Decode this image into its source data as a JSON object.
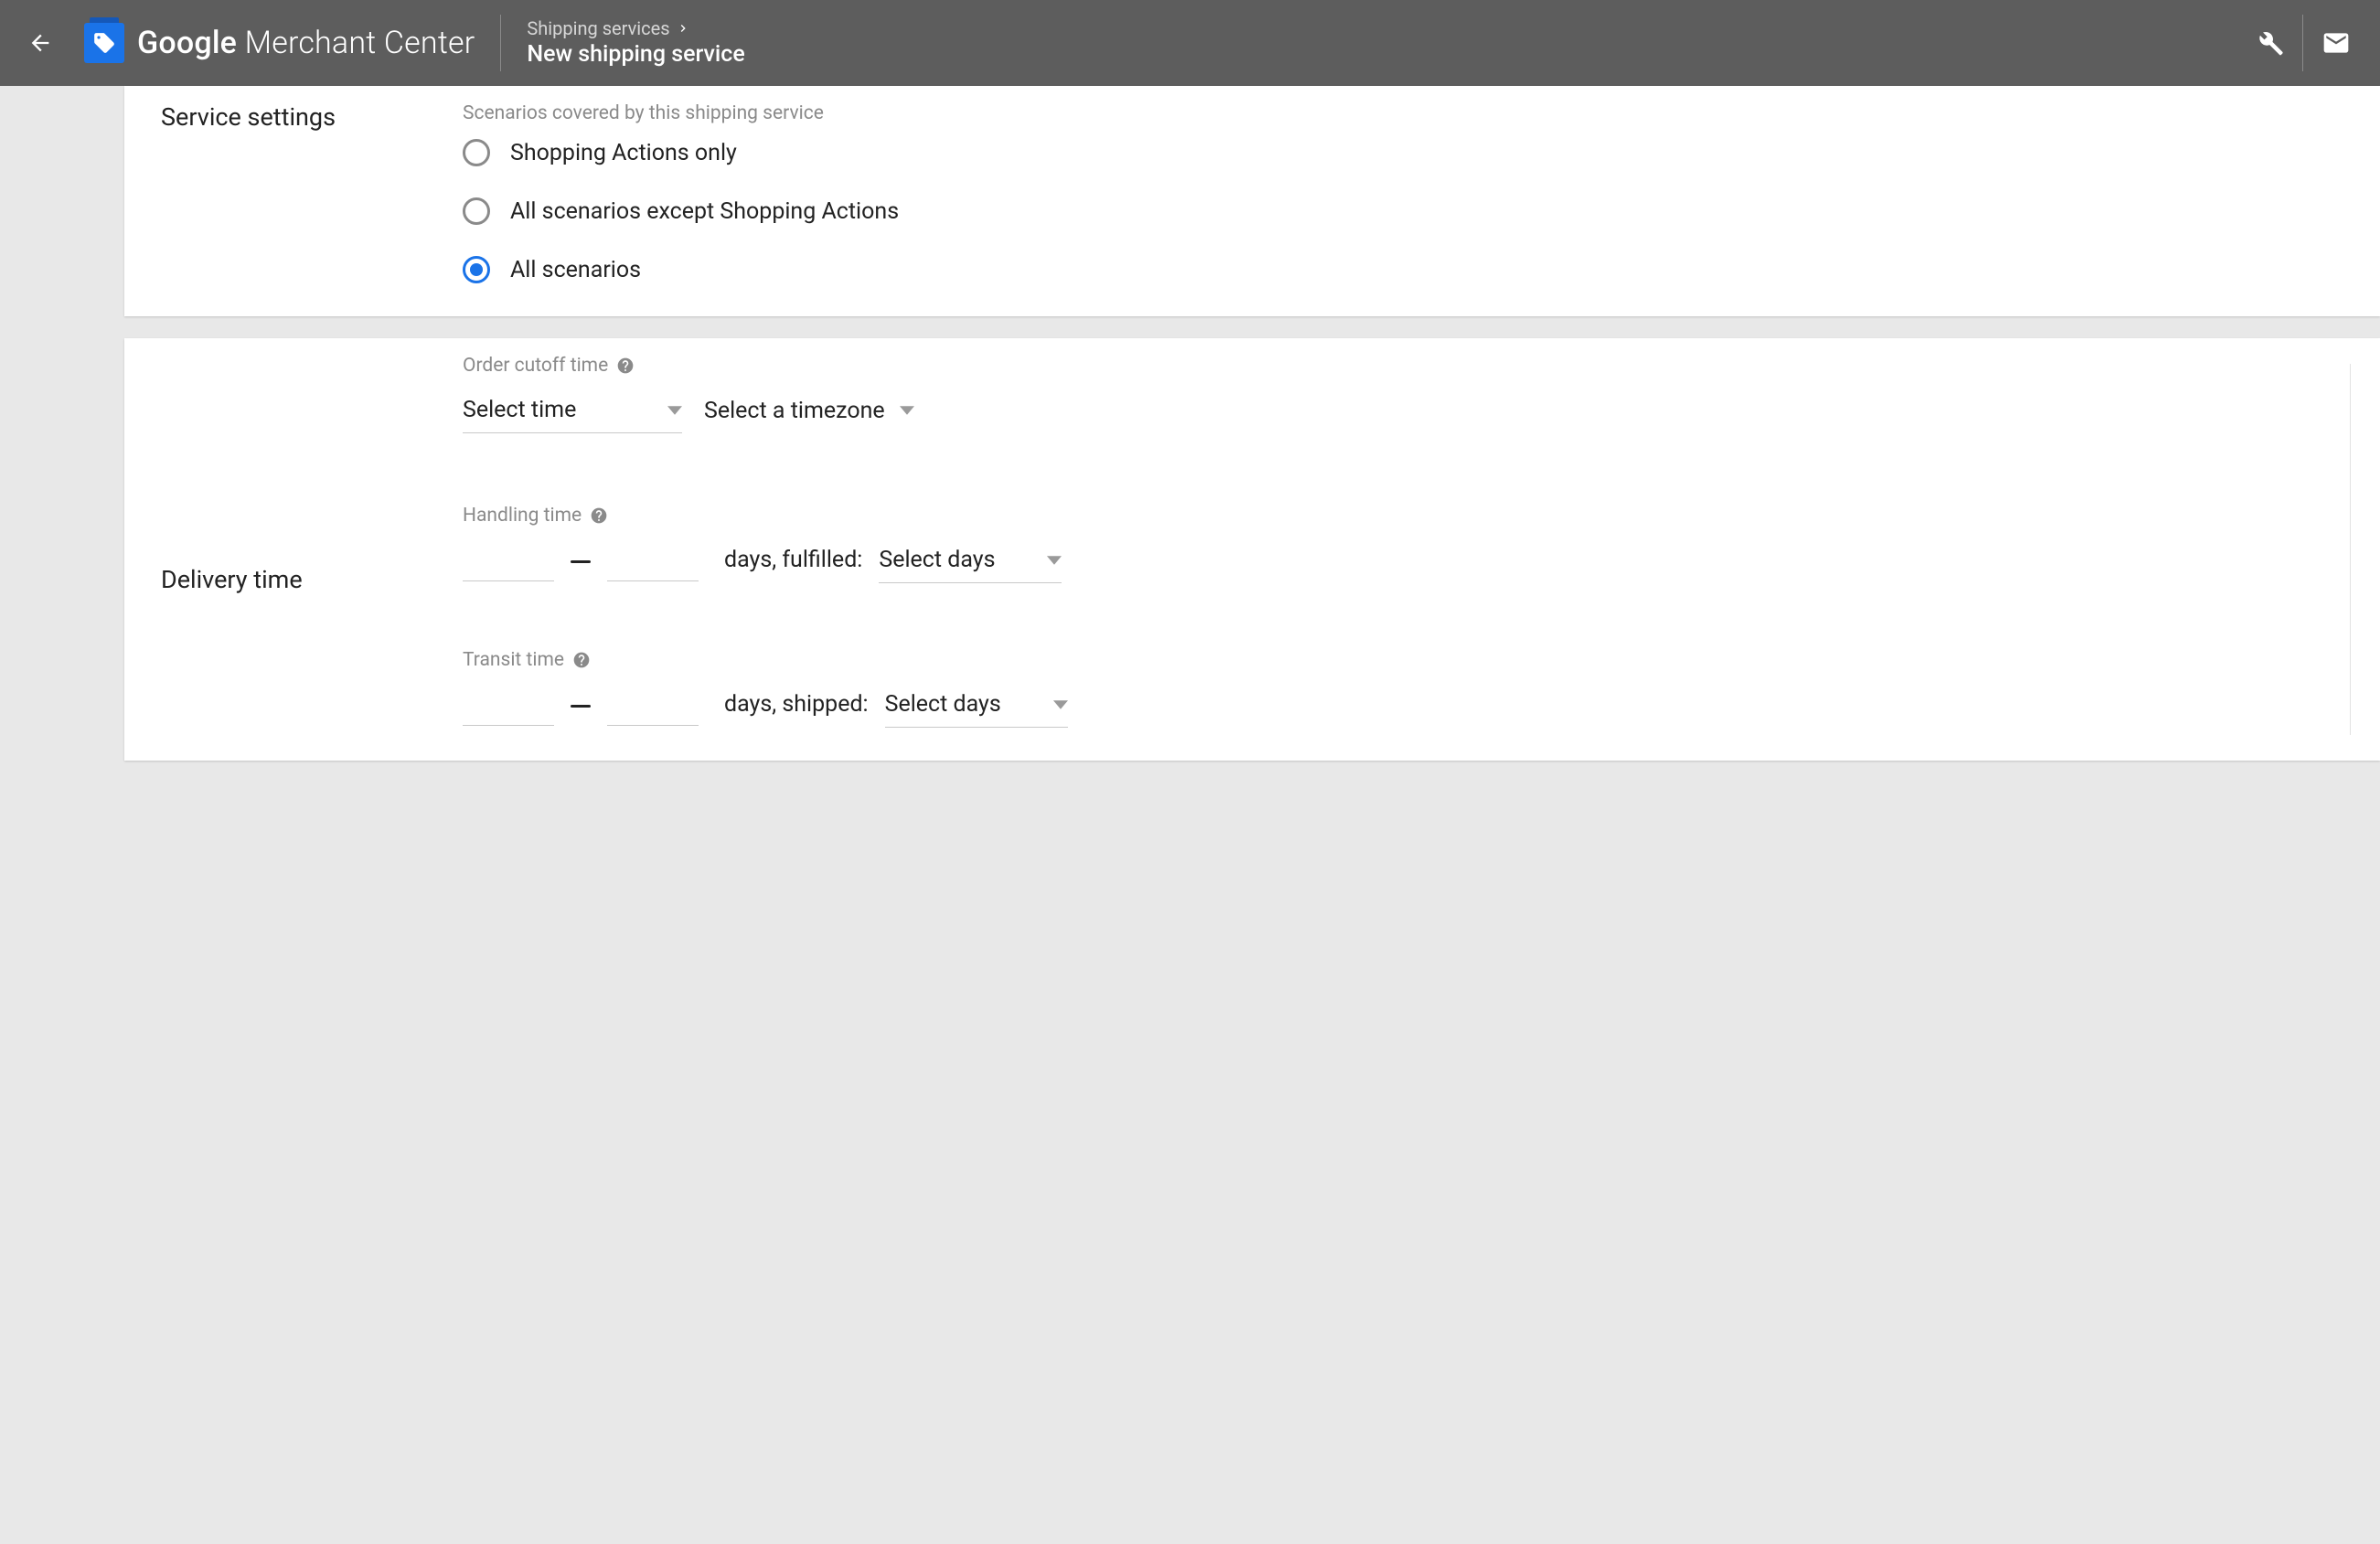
{
  "app": {
    "name_bold": "Google",
    "name_rest": " Merchant Center"
  },
  "breadcrumb": {
    "parent": "Shipping services",
    "title": "New shipping service"
  },
  "service_settings": {
    "section_label": "Service settings",
    "caption": "Scenarios covered by this shipping service",
    "options": [
      {
        "label": "Shopping Actions only",
        "selected": false
      },
      {
        "label": "All scenarios except Shopping Actions",
        "selected": false
      },
      {
        "label": "All scenarios",
        "selected": true
      }
    ]
  },
  "delivery": {
    "section_label": "Delivery time",
    "cutoff": {
      "caption": "Order cutoff time",
      "time_placeholder": "Select time",
      "tz_placeholder": "Select a timezone"
    },
    "handling": {
      "caption": "Handling time",
      "suffix": "days, fulfilled:",
      "days_placeholder": "Select days"
    },
    "transit": {
      "caption": "Transit time",
      "suffix": "days, shipped:",
      "days_placeholder": "Select days"
    }
  }
}
